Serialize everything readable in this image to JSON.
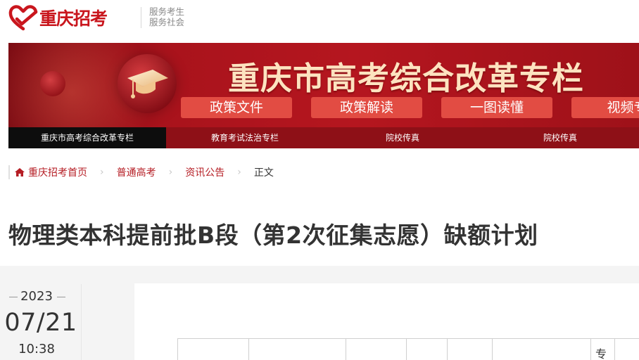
{
  "header": {
    "logo_text": "重庆招考",
    "slogan_line1": "服务考生",
    "slogan_line2": "服务社会",
    "brand_color": "#c9161d"
  },
  "banner": {
    "title": "重庆市高考综合改革专栏",
    "buttons": [
      "政策文件",
      "政策解读",
      "一图读懂",
      "视频专"
    ]
  },
  "nav": {
    "items": [
      {
        "label": "重庆市高考综合改革专栏",
        "active": true
      },
      {
        "label": "教育考试法治专栏",
        "active": false
      },
      {
        "label": "院校传真",
        "active": false
      },
      {
        "label": "院校传真",
        "active": false
      }
    ]
  },
  "breadcrumb": {
    "home": "重庆招考首页",
    "level1": "普通高考",
    "level2": "资讯公告",
    "current": "正文",
    "separator": "›"
  },
  "article": {
    "title": "物理类本科提前批B段（第2次征集志愿）缺额计划",
    "date_year": "2023",
    "date_md": "07/21",
    "date_time": "10:38",
    "table_cell_text": "专"
  },
  "icons": {
    "home": "home-icon",
    "logo": "heart-check-logo-icon",
    "cap": "graduation-cap-icon"
  }
}
